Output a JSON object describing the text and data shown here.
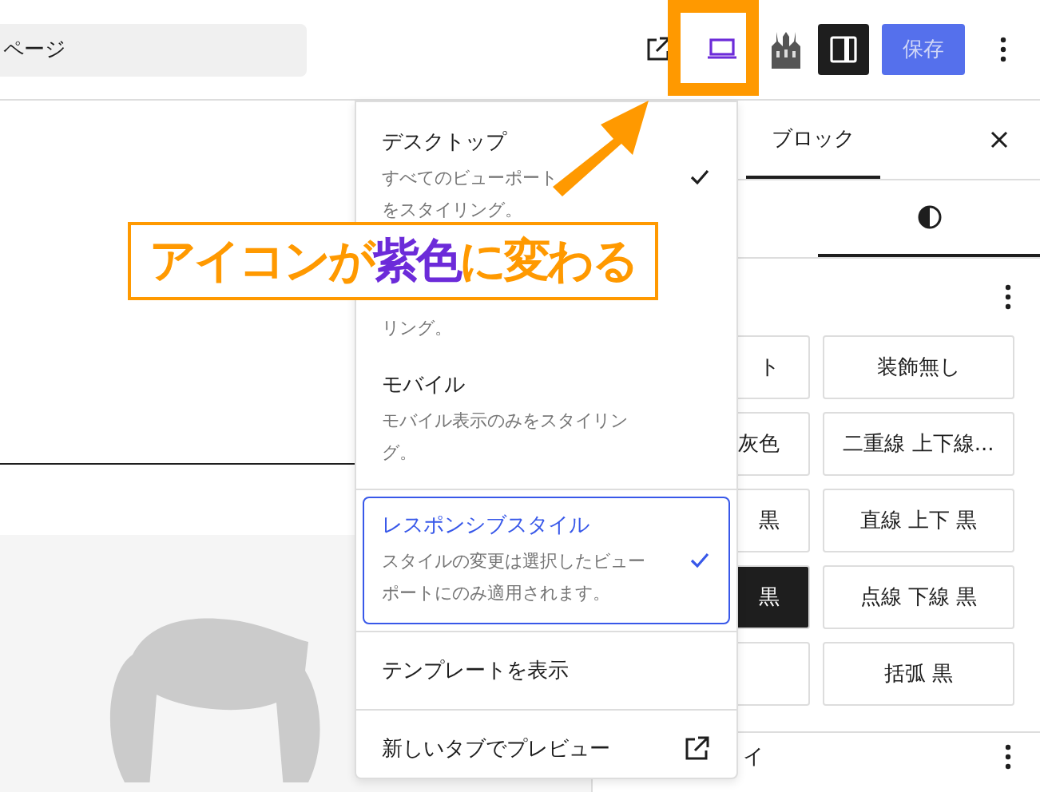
{
  "toolbar": {
    "search_value": "ページ",
    "device_preview_active": true,
    "save_label": "保存"
  },
  "sidebar": {
    "tabs": [
      {
        "label": "ブロック",
        "selected": true
      }
    ],
    "style_tabs": [
      {
        "kind": "contrast",
        "selected": true
      }
    ],
    "styles": [
      {
        "label": "ト",
        "selected": false
      },
      {
        "label": "装飾無し",
        "selected": false
      },
      {
        "label": "灰色",
        "selected": false
      },
      {
        "label": "二重線 上下線...",
        "selected": false
      },
      {
        "label": "黒",
        "selected": false
      },
      {
        "label": "直線 上下 黒",
        "selected": false
      },
      {
        "label": "黒",
        "selected": true
      },
      {
        "label": "点線 下線 黒",
        "selected": false
      },
      {
        "selected": false
      },
      {
        "label": "括弧 黒",
        "selected": false
      }
    ],
    "next_section": "イ"
  },
  "device_menu": {
    "sections": [
      [
        {
          "kind": "option",
          "title": "デスクトップ",
          "description": "すべてのビューポートをスタイリング。",
          "checked": true,
          "selected": false
        },
        {
          "kind": "option",
          "description": "リング。",
          "checked": false,
          "selected": false
        },
        {
          "kind": "option",
          "title": "モバイル",
          "description": "モバイル表示のみをスタイリング。",
          "checked": false,
          "selected": false
        }
      ],
      [
        {
          "kind": "option",
          "title": "レスポンシブスタイル",
          "description": "スタイルの変更は選択したビューポートにのみ適用されます。",
          "checked": true,
          "selected": true
        }
      ],
      [
        {
          "kind": "action",
          "title": "テンプレートを表示"
        }
      ],
      [
        {
          "kind": "external",
          "title": "新しいタブでプレビュー"
        }
      ]
    ]
  },
  "callout": {
    "segments": [
      {
        "text": "アイコンが",
        "color": "#ff9900"
      },
      {
        "text": "紫色",
        "color": "#6c2bd9"
      },
      {
        "text": "に変わる",
        "color": "#ff9900"
      }
    ]
  }
}
